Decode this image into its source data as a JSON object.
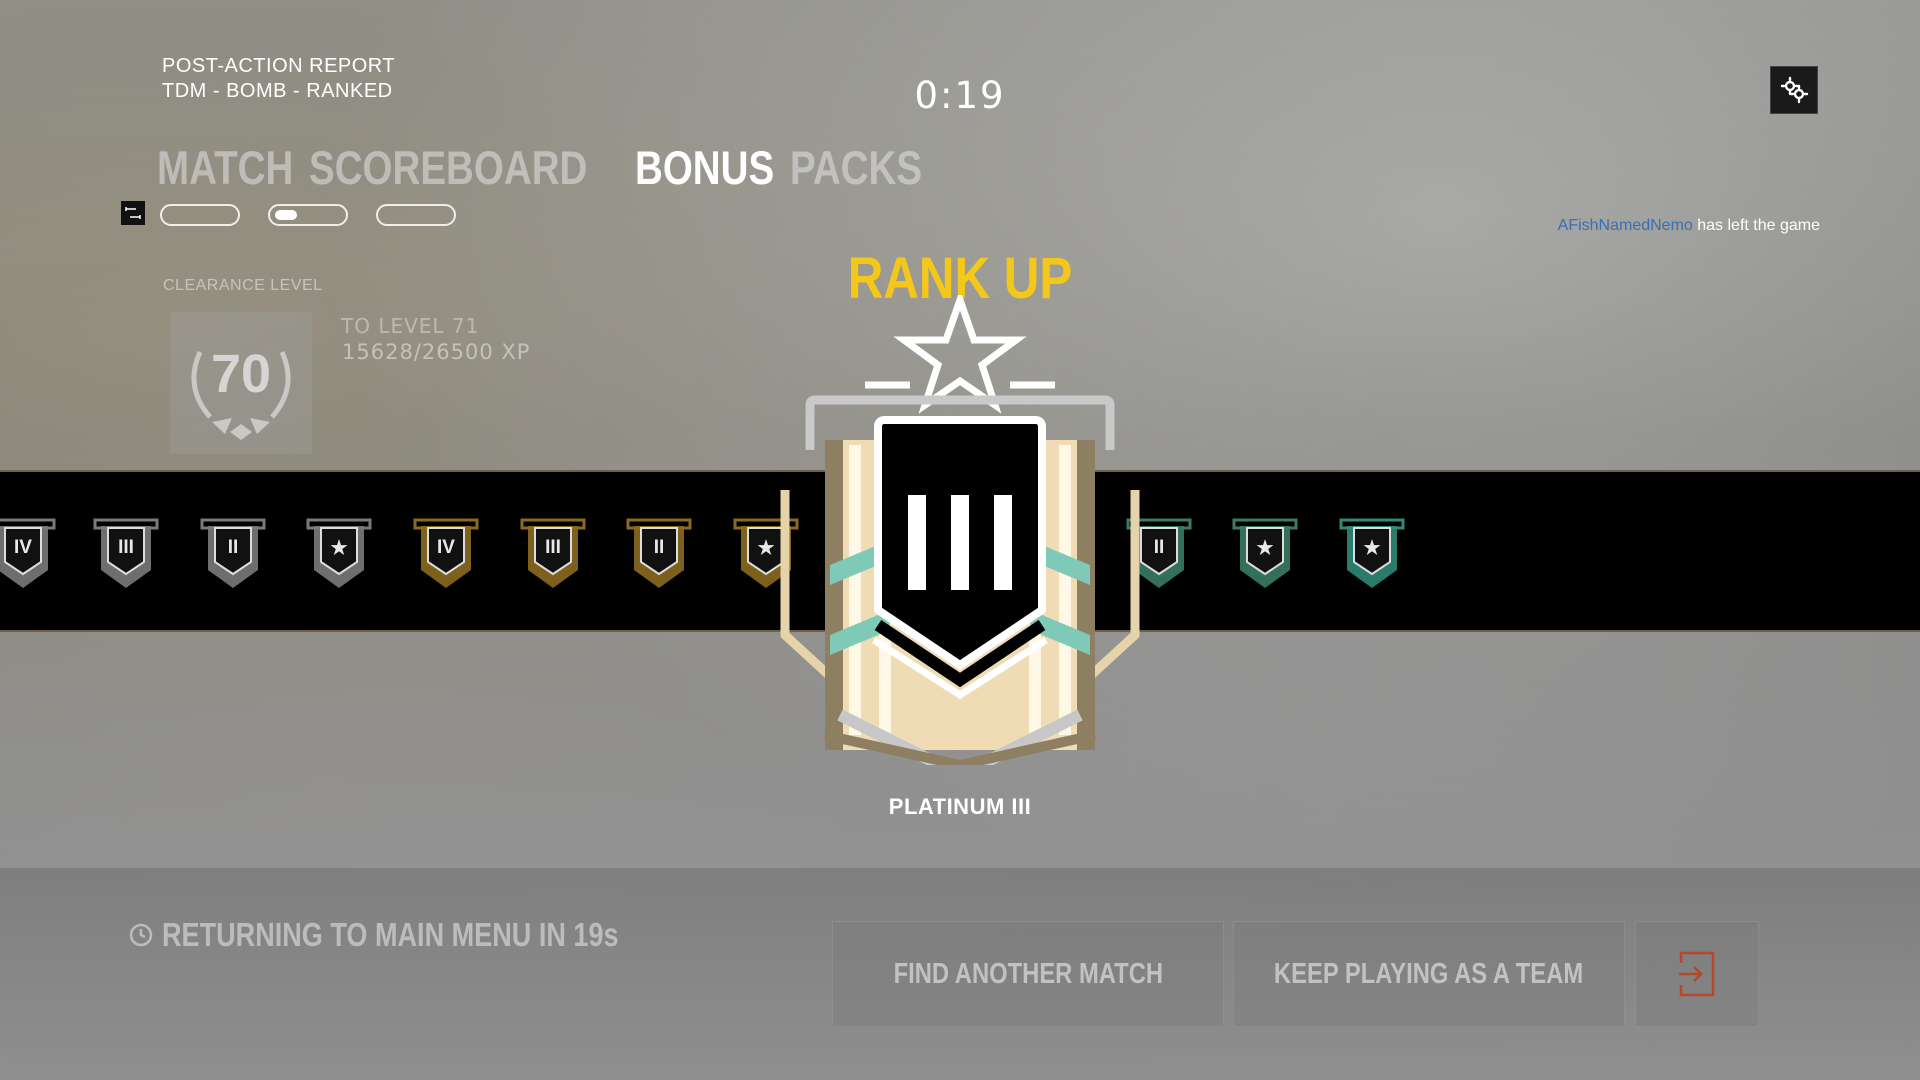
{
  "header": {
    "report_title": "POST-ACTION REPORT",
    "mode": "TDM - BOMB - RANKED",
    "timer": "0:19"
  },
  "tabs": [
    {
      "label": "MATCH",
      "active": false
    },
    {
      "label": "SCOREBOARD",
      "active": false
    },
    {
      "label": "BONUS",
      "active": true
    },
    {
      "label": "PACKS",
      "active": false
    }
  ],
  "clearance": {
    "label": "CLEARANCE LEVEL",
    "level": "70",
    "to_level": "TO LEVEL 71",
    "xp": "15628/26500 XP"
  },
  "notification": {
    "player": "AFishNamedNemo",
    "message": "has left the game"
  },
  "rank": {
    "heading": "RANK UP",
    "name": "PLATINUM III",
    "numeral": "III"
  },
  "rank_strip": [
    {
      "tier": "IV",
      "tone": "silver"
    },
    {
      "tier": "III",
      "tone": "silver"
    },
    {
      "tier": "II",
      "tone": "silver"
    },
    {
      "tier": "★",
      "tone": "silver"
    },
    {
      "tier": "IV",
      "tone": "gold"
    },
    {
      "tier": "III",
      "tone": "gold"
    },
    {
      "tier": "II",
      "tone": "gold"
    },
    {
      "tier": "★",
      "tone": "gold"
    },
    {
      "tier": "II",
      "tone": "platinum"
    },
    {
      "tier": "★",
      "tone": "platinum"
    },
    {
      "tier": "★",
      "tone": "diamond"
    }
  ],
  "footer": {
    "returning": "RETURNING TO MAIN MENU IN 19s",
    "find_match": "FIND ANOTHER MATCH",
    "keep_playing": "KEEP PLAYING AS A TEAM"
  },
  "colors": {
    "rank_heading": "#f4c81a",
    "player_name": "#3a6fb0",
    "silver": "#7a7a7a",
    "gold": "#8a6a1e",
    "platinum": "#3a7a66",
    "diamond": "#2f8a76"
  }
}
